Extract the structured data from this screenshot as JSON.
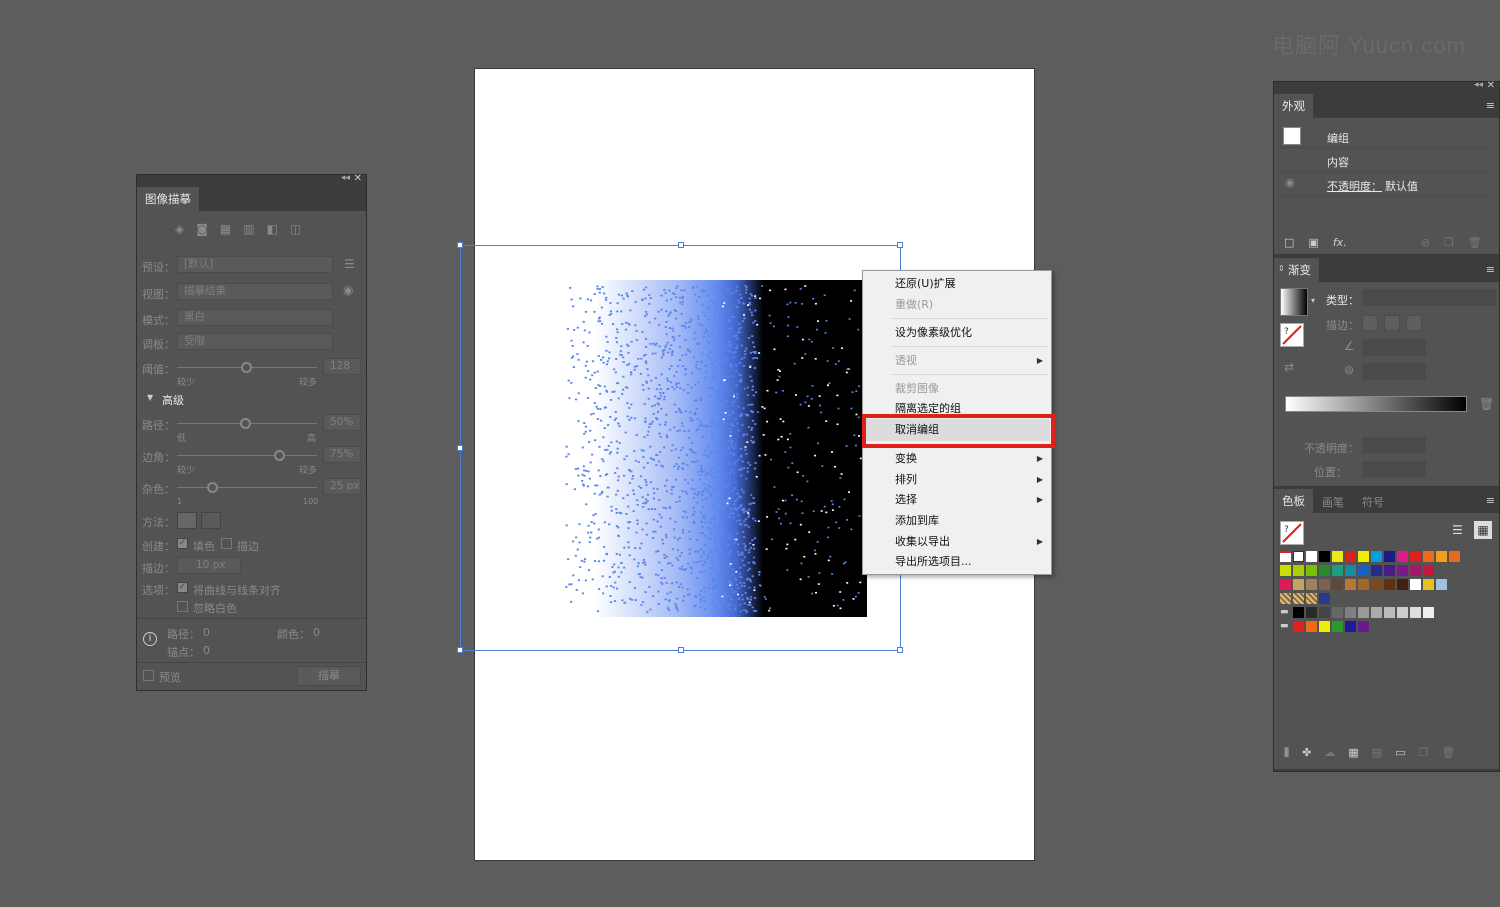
{
  "watermark": "电脑阿 Yuucn.com",
  "context_menu": {
    "items": [
      {
        "label": "还原(U)扩展",
        "enabled": true
      },
      {
        "label": "重做(R)",
        "enabled": false
      },
      {
        "label": "设为像素级优化",
        "enabled": true
      },
      {
        "label": "透视",
        "enabled": false,
        "submenu": true
      },
      {
        "label": "裁剪图像",
        "enabled": false
      },
      {
        "label": "隔离选定的组",
        "enabled": true
      },
      {
        "label": "取消编组",
        "enabled": true,
        "highlighted": true
      },
      {
        "label": "变换",
        "enabled": true,
        "submenu": true
      },
      {
        "label": "排列",
        "enabled": true,
        "submenu": true
      },
      {
        "label": "选择",
        "enabled": true,
        "submenu": true
      },
      {
        "label": "添加到库",
        "enabled": true
      },
      {
        "label": "收集以导出",
        "enabled": true,
        "submenu": true
      },
      {
        "label": "导出所选项目...",
        "enabled": true
      }
    ],
    "highlight_color": "#e0201a"
  },
  "image_trace_panel": {
    "title": "图像描摹",
    "preset_label": "预设：",
    "preset_value": "[默认]",
    "view_label": "视图：",
    "view_value": "描摹结果",
    "mode_label": "模式：",
    "mode_value": "黑白",
    "palette_label": "调板：",
    "palette_value": "受限",
    "threshold_label": "阈值：",
    "threshold_value": "128",
    "threshold_min": "较少",
    "threshold_max": "较多",
    "advanced_label": "高级",
    "paths_label": "路径：",
    "paths_value": "50%",
    "paths_min": "低",
    "paths_max": "高",
    "corners_label": "边角：",
    "corners_value": "75%",
    "corners_min": "较少",
    "corners_max": "较多",
    "noise_label": "杂色：",
    "noise_value": "25 px",
    "noise_min": "1",
    "noise_max": "100",
    "method_label": "方法：",
    "create_label": "创建：",
    "fill_label": "填色",
    "stroke_label": "描边",
    "stroke_width_label": "描边：",
    "stroke_width_value": "10 px",
    "options_label": "选项：",
    "snap_label": "将曲线与线条对齐",
    "ignore_white_label": "忽略白色",
    "paths_count_label": "路径：",
    "paths_count": "0",
    "colors_count_label": "颜色：",
    "colors_count": "0",
    "anchors_label": "锚点：",
    "anchors_count": "0",
    "preview_label": "预览",
    "trace_button": "描摹"
  },
  "appearance_panel": {
    "title": "外观",
    "group_label": "编组",
    "contents_label": "内容",
    "opacity_label": "不透明度：",
    "opacity_value": "默认值"
  },
  "gradient_panel": {
    "title": "渐变",
    "type_label": "类型：",
    "stroke_label": "描边：",
    "opacity_label": "不透明度：",
    "location_label": "位置："
  },
  "swatches_panel": {
    "tabs": [
      "色板",
      "画笔",
      "符号"
    ]
  },
  "colors": {
    "accent_blue": "#4a7fd8",
    "particle_blue": "#5b84ee"
  }
}
